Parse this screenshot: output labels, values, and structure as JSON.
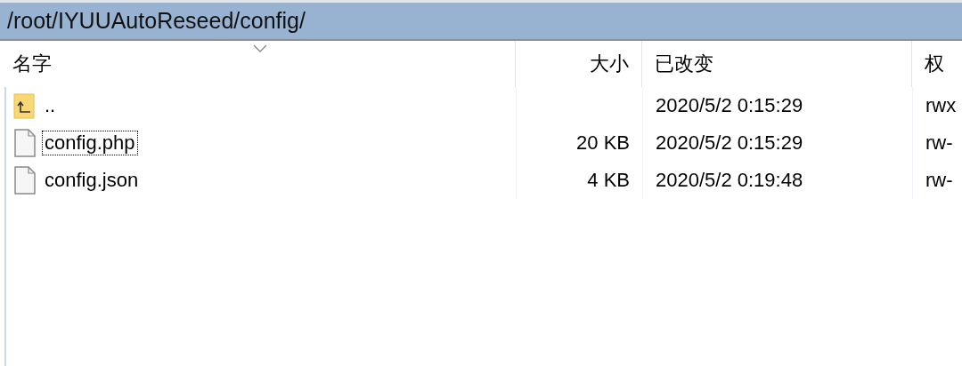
{
  "path_bar": {
    "path": "/root/IYUUAutoReseed/config/"
  },
  "columns": [
    {
      "label": "名字",
      "sorted": true
    },
    {
      "label": "大小",
      "sorted": false
    },
    {
      "label": "已改变",
      "sorted": false
    },
    {
      "label": "权",
      "sorted": false
    }
  ],
  "rows": [
    {
      "kind": "parent",
      "name": "..",
      "size": null,
      "modified": "2020/5/2 0:15:29",
      "permissions": "rwx",
      "focused": false
    },
    {
      "kind": "file",
      "name": "config.php",
      "size": "20 KB",
      "modified": "2020/5/2 0:15:29",
      "permissions": "rw-",
      "focused": true
    },
    {
      "kind": "file",
      "name": "config.json",
      "size": "4 KB",
      "modified": "2020/5/2 0:19:48",
      "permissions": "rw-",
      "focused": false
    }
  ]
}
